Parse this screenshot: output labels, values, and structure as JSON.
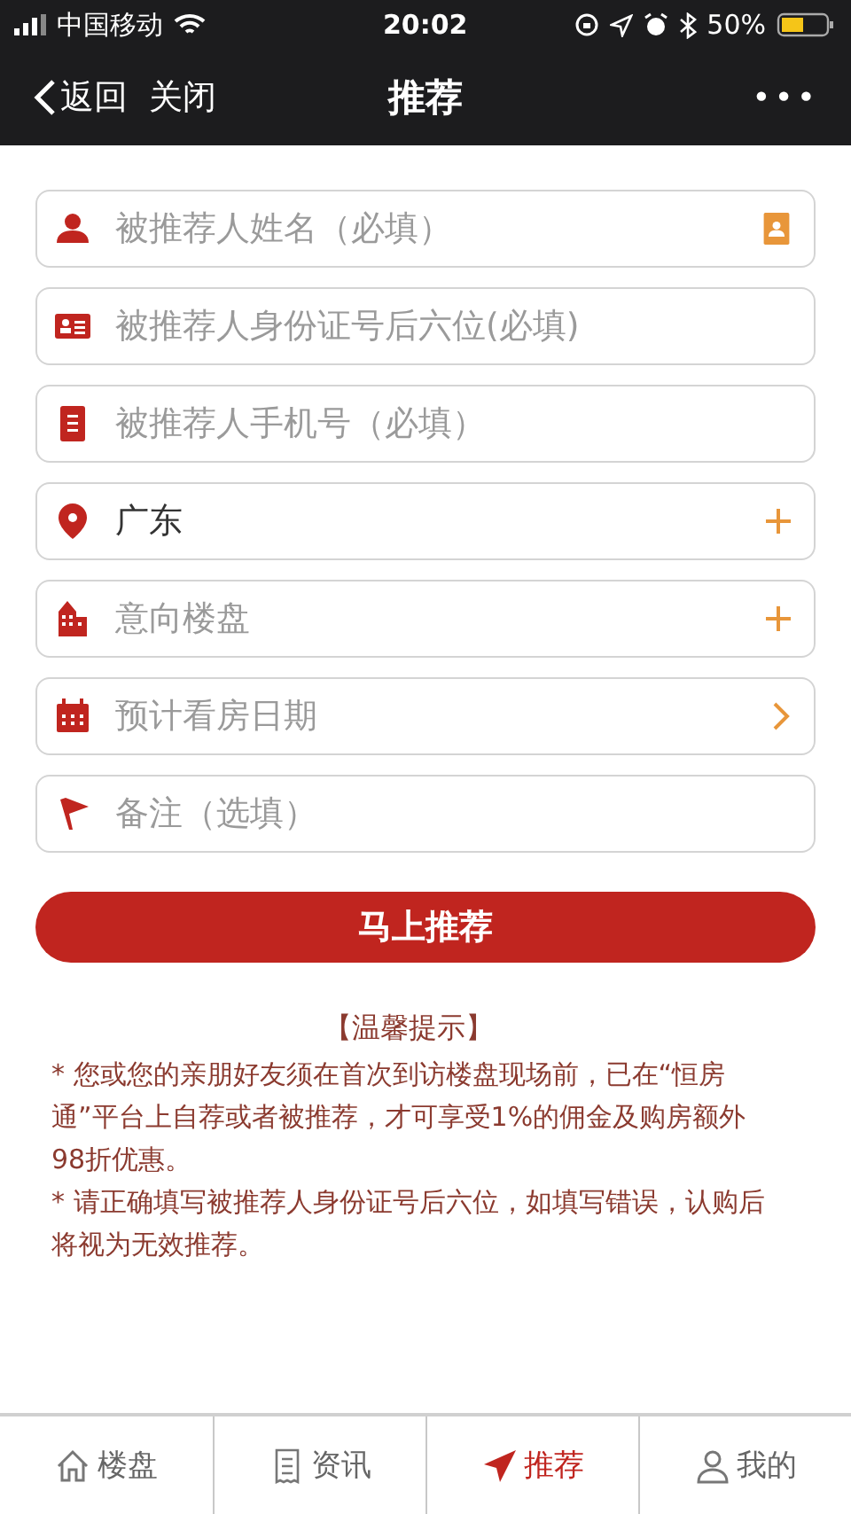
{
  "status_bar": {
    "carrier": "中国移动",
    "time": "20:02",
    "battery": "50%"
  },
  "nav": {
    "back": "返回",
    "close": "关闭",
    "title": "推荐",
    "more": "•••"
  },
  "fields": [
    {
      "kind": "contact",
      "placeholder": "被推荐人姓名（必填）"
    },
    {
      "kind": "none",
      "placeholder": "被推荐人身份证号后六位(必填)"
    },
    {
      "kind": "none",
      "placeholder": "被推荐人手机号（必填）"
    },
    {
      "kind": "plus",
      "value": "广东"
    },
    {
      "kind": "plus",
      "placeholder": "意向楼盘"
    },
    {
      "kind": "chevron",
      "placeholder": "预计看房日期"
    },
    {
      "kind": "none",
      "placeholder": "备注（选填）"
    }
  ],
  "submit": "马上推荐",
  "tips": {
    "title": "【温馨提示】",
    "items": [
      "* 您或您的亲朋好友须在首次到访楼盘现场前，已在“恒房通”平台上自荐或者被推荐，才可享受1%的佣金及购房额外98折优惠。",
      "* 请正确填写被推荐人身份证号后六位，如填写错误，认购后将视为无效推荐。"
    ]
  },
  "tabs": [
    {
      "label": "楼盘",
      "selected": false
    },
    {
      "label": "资讯",
      "selected": false
    },
    {
      "label": "推荐",
      "selected": true
    },
    {
      "label": "我的",
      "selected": false
    }
  ]
}
